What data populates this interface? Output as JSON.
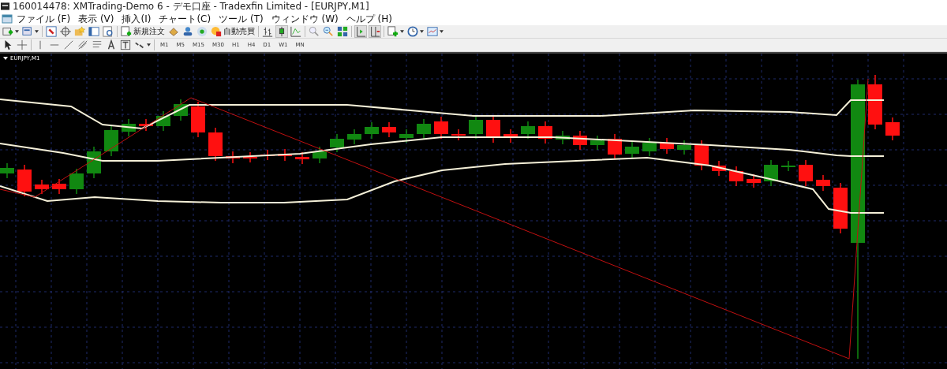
{
  "window": {
    "title": "160014478: XMTrading-Demo 6 - デモ口座 - Tradexfin Limited - [EURJPY,M1]"
  },
  "menu": [
    "ファイル (F)",
    "表示 (V)",
    "挿入(I)",
    "チャート(C)",
    "ツール (T)",
    "ウィンドウ (W)",
    "ヘルプ (H)"
  ],
  "toolbar": {
    "new_order": "新規注文",
    "auto_trading": "自動売買"
  },
  "timeframes": [
    "M1",
    "M5",
    "M15",
    "M30",
    "H1",
    "H4",
    "D1",
    "W1",
    "MN"
  ],
  "chart": {
    "title": "EURJPY,M1"
  }
}
